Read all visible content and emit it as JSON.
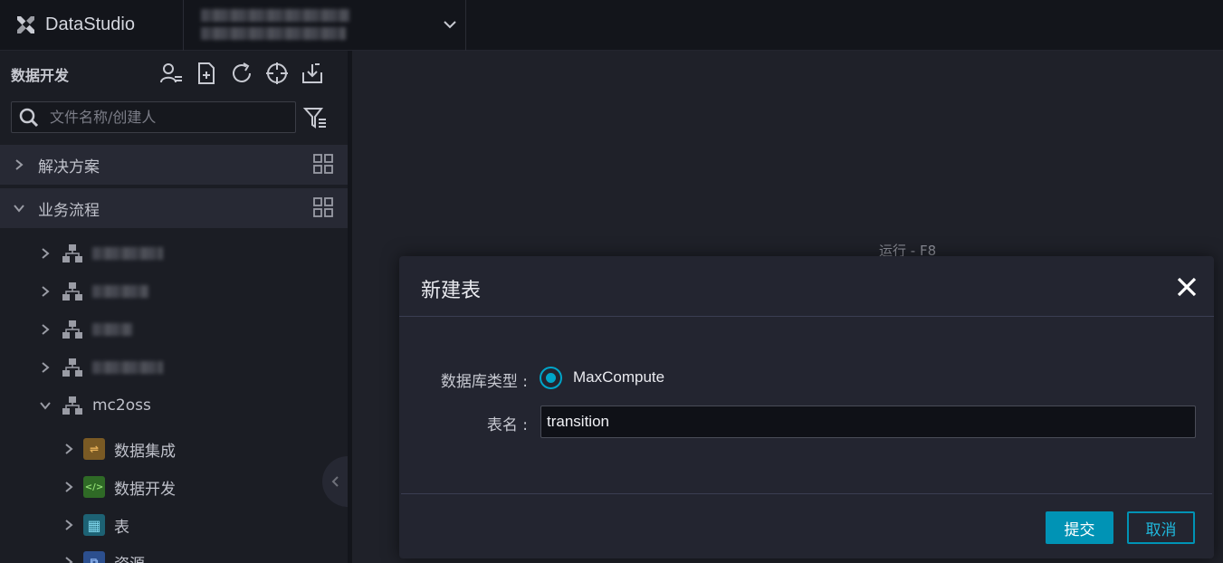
{
  "app": {
    "name": "DataStudio"
  },
  "sidebar": {
    "title": "数据开发",
    "tools": [
      "user-icon",
      "new-file-icon",
      "refresh-icon",
      "locate-icon",
      "import-icon"
    ],
    "search_placeholder": "文件名称/创建人",
    "sections": [
      {
        "label": "解决方案",
        "expanded": false
      },
      {
        "label": "业务流程",
        "expanded": true
      }
    ],
    "workflows": [
      {
        "name": "mc2oss",
        "expanded": true
      }
    ],
    "children": [
      {
        "label": "数据集成",
        "icon": "data-integration-icon",
        "color": "#b07d2c",
        "glyph": "⇌"
      },
      {
        "label": "数据开发",
        "icon": "code-icon",
        "color": "#3f8a31",
        "glyph": "</>"
      },
      {
        "label": "表",
        "icon": "table-icon",
        "color": "#1f7c92",
        "glyph": "▦"
      },
      {
        "label": "资源",
        "icon": "resource-icon",
        "color": "#3a6bc4",
        "glyph": "⧉"
      }
    ]
  },
  "main": {
    "hint_run": "运行 - F8"
  },
  "modal": {
    "title": "新建表",
    "db_type_label": "数据库类型 :",
    "db_type_value": "MaxCompute",
    "table_name_label": "表名 :",
    "table_name_value": "transition",
    "submit_label": "提交",
    "cancel_label": "取消"
  },
  "colors": {
    "accent": "#0093b5",
    "background": "#1f2129",
    "sidebar": "#1b1d24"
  }
}
